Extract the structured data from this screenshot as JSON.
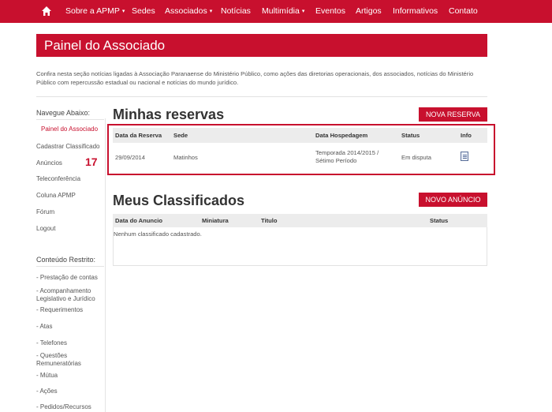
{
  "nav": {
    "items": [
      {
        "label": "Sobre a APMP",
        "dropdown": true
      },
      {
        "label": "Sedes",
        "dropdown": false
      },
      {
        "label": "Associados",
        "dropdown": true
      },
      {
        "label": "Notícias",
        "dropdown": false
      },
      {
        "label": "Multimídia",
        "dropdown": true
      },
      {
        "label": "Eventos",
        "dropdown": false
      },
      {
        "label": "Artigos",
        "dropdown": false
      },
      {
        "label": "Informativos",
        "dropdown": false
      },
      {
        "label": "Contato",
        "dropdown": false
      }
    ],
    "caret": "▾",
    "home_icon": "home-icon"
  },
  "page": {
    "title": "Painel do Associado",
    "intro": "Confira nesta seção notícias ligadas à Associação Paranaense do Ministério Público, como ações das diretorias operacionais, dos associados, notícias do Ministério Público com repercussão estadual ou nacional e notícias do mundo jurídico."
  },
  "sidebar": {
    "heading": "Navegue Abaixo:",
    "links": [
      "Painel do Associado",
      "Cadastrar Classificado",
      "Anúncios",
      "Teleconferência",
      "Coluna APMP",
      "Fórum",
      "Logout"
    ],
    "active_index": 0,
    "annotation": "17",
    "restricted_heading": "Conteúdo Restrito:",
    "restricted_links": [
      "- Prestação de contas",
      "- Acompanhamento Legislativo e Jurídico",
      "- Requerimentos",
      "- Atas",
      "- Telefones",
      "- Questões Remuneratórias",
      "- Mútua",
      "- Ações",
      "- Pedidos/Recursos"
    ]
  },
  "reservas": {
    "title": "Minhas reservas",
    "button": "NOVA RESERVA",
    "headers": [
      "Data da Reserva",
      "Sede",
      "Data Hospedagem",
      "Status",
      "Info"
    ],
    "rows": [
      {
        "data": "29/09/2014",
        "sede": "Matinhos",
        "hospedagem": "Temporada 2014/2015 / Sétimo Período",
        "status": "Em disputa",
        "info_icon": "document-icon"
      }
    ]
  },
  "classificados": {
    "title": "Meus Classificados",
    "button": "NOVO ANÚNCIO",
    "headers": [
      "Data do Anuncio",
      "Miniatura",
      "Titulo",
      "Status"
    ],
    "empty": "Nenhum classificado cadastrado."
  },
  "colors": {
    "brand": "#c8102e"
  }
}
